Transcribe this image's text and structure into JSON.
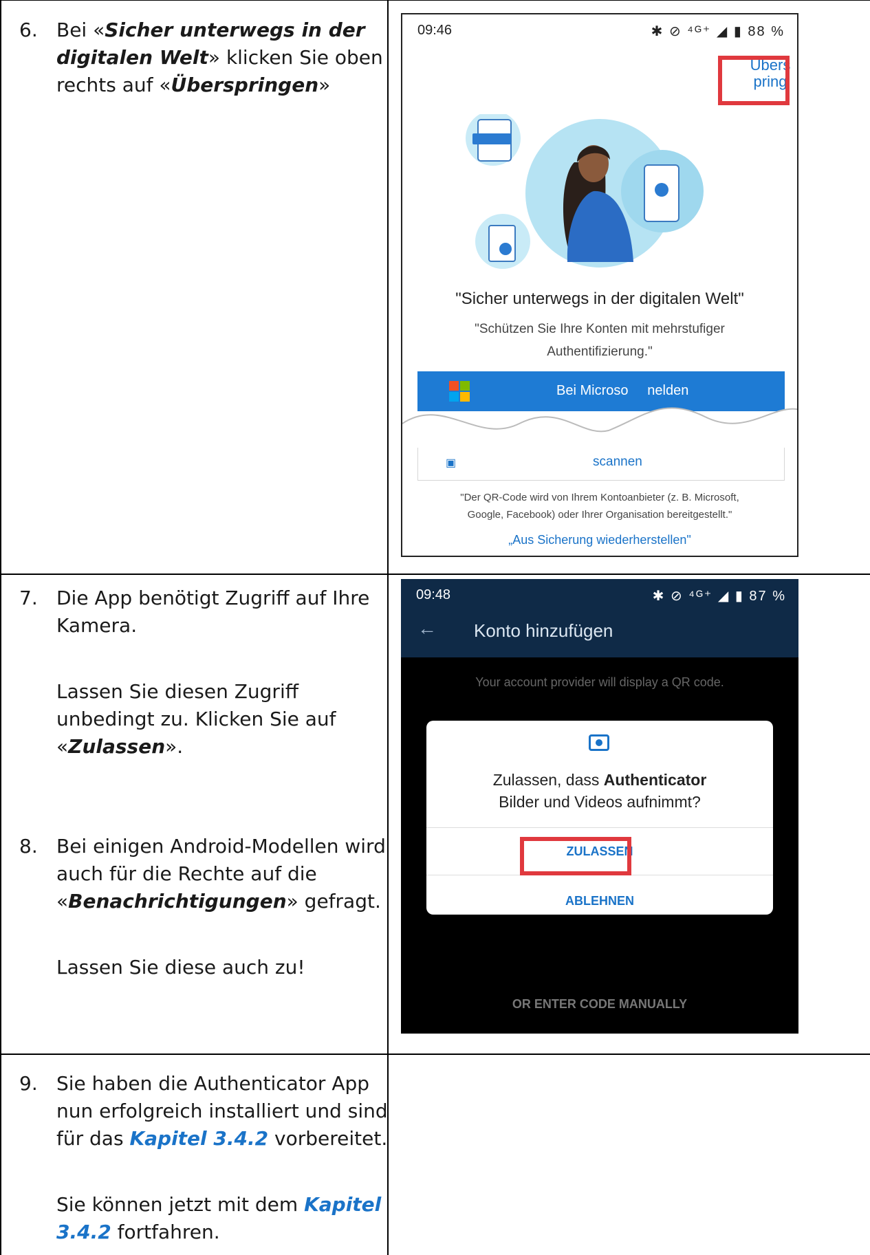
{
  "steps": [
    {
      "num": "6.",
      "p": [
        {
          "parts": [
            {
              "t": "Bei «"
            },
            {
              "t": "Sicher unterwegs in der digitalen Welt",
              "s": "bi"
            },
            {
              "t": "» klicken Sie oben rechts auf «"
            },
            {
              "t": "Überspringen",
              "s": "bi"
            },
            {
              "t": "»"
            }
          ]
        }
      ]
    },
    {
      "num": "7.",
      "p": [
        {
          "parts": [
            {
              "t": "Die App benötigt Zugriff auf Ihre Kamera."
            }
          ]
        },
        {
          "parts": [
            {
              "t": "Lassen Sie diesen Zugriff unbedingt zu. Klicken Sie auf «"
            },
            {
              "t": "Zulassen",
              "s": "bi"
            },
            {
              "t": "»."
            }
          ]
        }
      ]
    },
    {
      "num": "8.",
      "p": [
        {
          "parts": [
            {
              "t": "Bei einigen Android-Modellen wird auch für die Rechte auf die «"
            },
            {
              "t": "Benachrichtigungen",
              "s": "bi"
            },
            {
              "t": "» gefragt."
            }
          ]
        },
        {
          "parts": [
            {
              "t": "Lassen Sie diese auch zu!"
            }
          ]
        }
      ]
    },
    {
      "num": "9.",
      "p": [
        {
          "parts": [
            {
              "t": "Sie haben die Authenticator App nun erfolgreich installiert und sind für das "
            },
            {
              "t": "Kapitel 3.4.2",
              "s": "blue"
            },
            {
              "t": " vorbereitet."
            }
          ]
        },
        {
          "parts": [
            {
              "t": "Sie können jetzt mit dem "
            },
            {
              "t": "Kapitel 3.4.2",
              "s": "blue"
            },
            {
              "t": " fortfahren."
            }
          ]
        }
      ]
    }
  ],
  "shot1": {
    "time": "09:46",
    "indicators": "✱ ⊘ ⁴ᴳ⁺ ◢ ▮ 88 %",
    "skip_line1": "Übers",
    "skip_line2": "pring",
    "heading": "\"Sicher unterwegs in der digitalen Welt\"",
    "sub1": "\"Schützen Sie Ihre Konten mit mehrstufiger",
    "sub2": "Authentifizierung.\"",
    "signin": "Bei Microso     nelden",
    "scan": "scannen",
    "note1": "\"Der QR-Code wird von Ihrem Kontoanbieter (z. B. Microsoft,",
    "note2": "Google, Facebook) oder Ihrer Organisation bereitgestellt.\"",
    "restore": "„Aus Sicherung wiederherstellen\""
  },
  "shot2": {
    "time": "09:48",
    "indicators": "✱ ⊘ ⁴ᴳ⁺ ◢ ▮ 87 %",
    "title": "Konto hinzufügen",
    "provider": "Your account provider will display a QR code.",
    "dialog_pre": "Zulassen, dass ",
    "dialog_app": "Authenticator",
    "dialog_line2": "Bilder und Videos aufnimmt?",
    "allow": "ZULASSEN",
    "deny": "ABLEHNEN",
    "manual": "OR ENTER CODE MANUALLY"
  },
  "colors": {
    "accent": "#1a73c8",
    "red": "#e0393e",
    "appbar": "#0f2a47",
    "ms_blue": "#1e7bd4"
  }
}
